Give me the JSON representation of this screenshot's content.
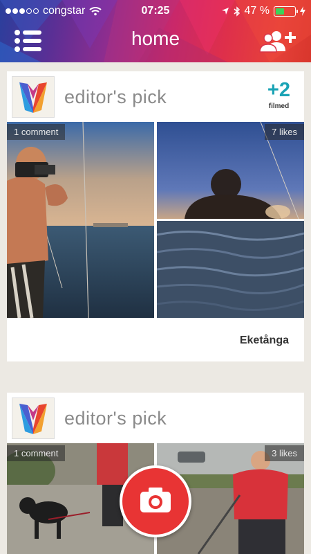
{
  "status_bar": {
    "carrier": "congstar",
    "time": "07:25",
    "battery_text": "47 %",
    "battery_level": 0.47
  },
  "nav": {
    "title": "home",
    "menu_icon": "list-menu-icon",
    "add_friend_icon": "add-users-icon"
  },
  "posts": [
    {
      "title": "editor's pick",
      "count": "+2",
      "count_label": "filmed",
      "comments": "1 comment",
      "likes": "7 likes",
      "place": "Eketånga"
    },
    {
      "title": "editor's pick",
      "comments": "1 comment",
      "likes": "3 likes"
    }
  ],
  "colors": {
    "accent_teal": "#1aa3b5",
    "record_red": "#e83434",
    "background": "#ece9e3"
  },
  "camera_button": {
    "icon": "camera-icon"
  }
}
